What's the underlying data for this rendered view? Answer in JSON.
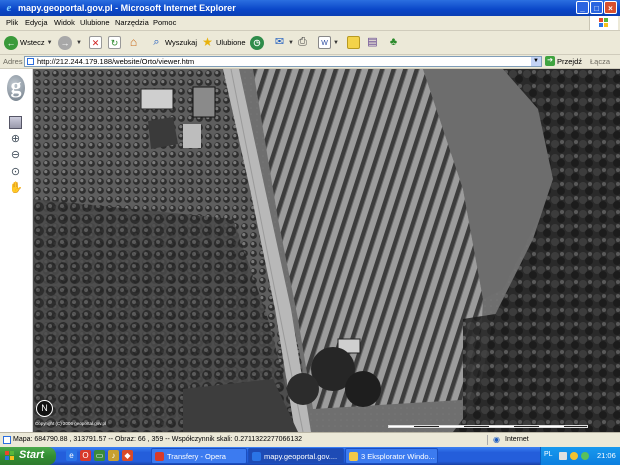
{
  "window": {
    "title": "mapy.geoportal.gov.pl - Microsoft Internet Explorer"
  },
  "menu": [
    "Plik",
    "Edycja",
    "Widok",
    "Ulubione",
    "Narzędzia",
    "Pomoc"
  ],
  "toolbar": {
    "back_label": "Wstecz",
    "search_label": "Wyszukaj",
    "favorites_label": "Ulubione"
  },
  "address_bar": {
    "label": "Adres",
    "url": "http://212.244.179.188/website/Orto/viewer.htm",
    "go_label": "Przejdź",
    "links_label": "Łącza"
  },
  "map": {
    "copyright": "Copyright (C) 2006 geoportal.gov.pl",
    "north_label": "N"
  },
  "status": {
    "text": "Mapa: 684790.88 , 313791.57 -- Obraz: 66 , 359 -- Współczynnik skali: 0.2711322277066132",
    "zone": "Internet"
  },
  "taskbar": {
    "start_label": "Start",
    "tasks": [
      {
        "label": "Transfery - Opera"
      },
      {
        "label": "mapy.geoportal.gov...."
      },
      {
        "label": "3 Eksplorator Windo..."
      }
    ],
    "language": "PL",
    "clock": "21:06"
  },
  "icons": {
    "back": "back-arrow-icon",
    "forward": "forward-arrow-icon",
    "stop": "stop-icon",
    "refresh": "refresh-icon",
    "home": "home-icon",
    "search": "search-icon",
    "favorites": "star-icon",
    "history": "history-icon",
    "mail": "mail-icon",
    "print": "print-icon",
    "edit": "edit-icon",
    "discuss": "discuss-icon",
    "messenger": "messenger-icon",
    "layers": "layers-icon",
    "zoom_in": "zoom-in-icon",
    "zoom_out": "zoom-out-icon",
    "zoom_extent": "zoom-extent-icon",
    "pan": "pan-hand-icon"
  },
  "colors": {
    "titlebar": "#0a46c8",
    "taskbar": "#245edb",
    "start": "#338e33"
  }
}
